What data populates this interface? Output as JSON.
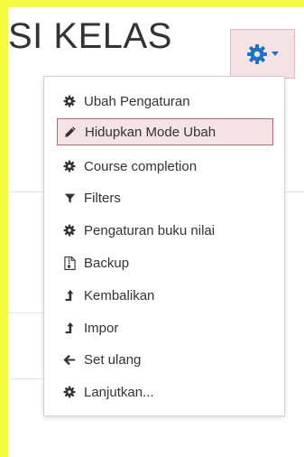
{
  "header": {
    "title": "SI KELAS",
    "settings_button_icon": "gear-icon",
    "dropdown_icon": "caret-down-icon",
    "accent_color": "#1f72c1"
  },
  "menu": {
    "items": [
      {
        "label": "Ubah Pengaturan",
        "icon": "gear-icon"
      },
      {
        "label": "Hidupkan Mode Ubah",
        "icon": "pencil-icon",
        "active": true
      },
      {
        "label": "Course completion",
        "icon": "gear-icon"
      },
      {
        "label": "Filters",
        "icon": "filter-icon"
      },
      {
        "label": "Pengaturan buku nilai",
        "icon": "gear-icon"
      },
      {
        "label": "Backup",
        "icon": "file-archive-icon"
      },
      {
        "label": "Kembalikan",
        "icon": "level-up-icon"
      },
      {
        "label": "Impor",
        "icon": "level-up-icon"
      },
      {
        "label": "Set ulang",
        "icon": "arrow-left-icon"
      },
      {
        "label": "Lanjutkan...",
        "icon": "gear-icon"
      }
    ]
  }
}
